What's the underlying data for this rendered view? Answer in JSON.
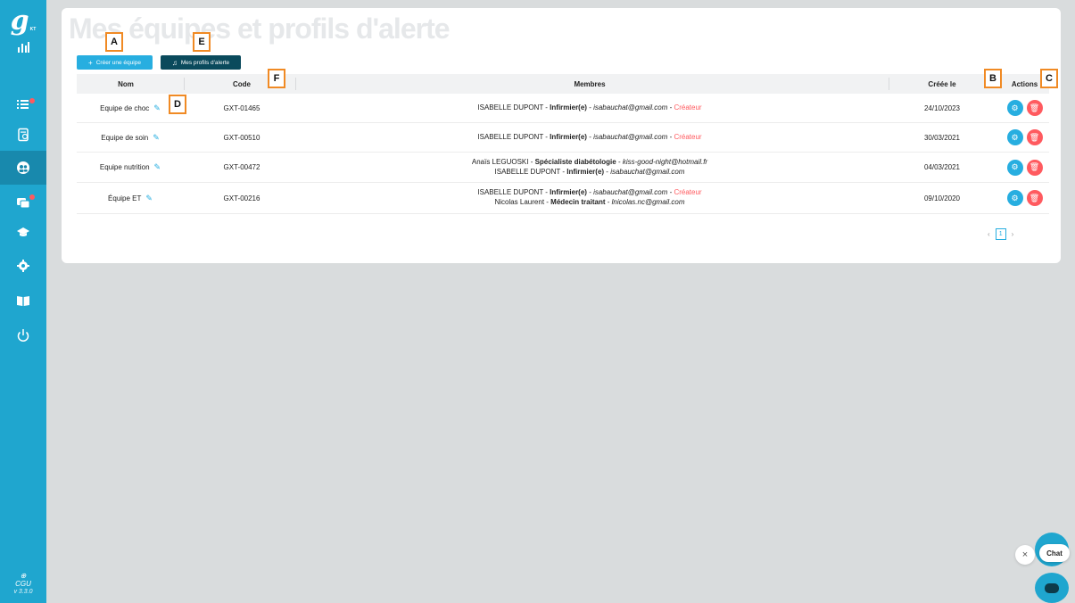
{
  "app": {
    "logo_letter": "g",
    "logo_sub": "KT"
  },
  "page": {
    "title": "Mes équipes et profils d'alerte"
  },
  "toolbar": {
    "create_team_label": "Créer une équipe",
    "alert_profiles_label": "Mes profils d'alerte"
  },
  "table": {
    "headers": {
      "name": "Nom",
      "code": "Code",
      "members": "Membres",
      "created": "Créée le",
      "actions": "Actions"
    },
    "rows": [
      {
        "name": "Equipe de choc",
        "code": "GXT-01465",
        "created": "24/10/2023",
        "members": [
          {
            "name": "ISABELLE DUPONT",
            "role": "Infirmier(e)",
            "email": "isabauchat@gmail.com",
            "tag": "Créateur"
          }
        ]
      },
      {
        "name": "Equipe de soin",
        "code": "GXT-00510",
        "created": "30/03/2021",
        "members": [
          {
            "name": "ISABELLE DUPONT",
            "role": "Infirmier(e)",
            "email": "isabauchat@gmail.com",
            "tag": "Créateur"
          }
        ]
      },
      {
        "name": "Equipe nutrition",
        "code": "GXT-00472",
        "created": "04/03/2021",
        "members": [
          {
            "name": "Anaïs LEGUOSKI",
            "role": "Spécialiste diabétologie",
            "email": "kiss-good-night@hotmail.fr",
            "tag": ""
          },
          {
            "name": "ISABELLE DUPONT",
            "role": "Infirmier(e)",
            "email": "isabauchat@gmail.com",
            "tag": ""
          }
        ]
      },
      {
        "name": "Équipe ET",
        "code": "GXT-00216",
        "created": "09/10/2020",
        "members": [
          {
            "name": "ISABELLE DUPONT",
            "role": "Infirmier(e)",
            "email": "isabauchat@gmail.com",
            "tag": "Créateur"
          },
          {
            "name": "Nicolas Laurent",
            "role": "Médecin traitant",
            "email": "lnicolas.nc@gmail.com",
            "tag": ""
          }
        ]
      }
    ]
  },
  "pagination": {
    "current": "1",
    "prev": "‹",
    "next": "›"
  },
  "markers": {
    "a": "A",
    "b": "B",
    "c": "C",
    "d": "D",
    "e": "E",
    "f": "F"
  },
  "footer": {
    "cgu": "CGU",
    "version": "v 3.3.0"
  },
  "chat": {
    "label": "Chat",
    "close": "×"
  },
  "colors": {
    "sidebar": "#1fa6cf",
    "primary": "#27aee0",
    "danger": "#ff5a5f",
    "dark_button": "#0a4a5c",
    "marker_border": "#f08a24"
  },
  "icons": {
    "nav": [
      "chart-icon",
      "list-icon",
      "document-icon",
      "teams-icon",
      "chat-icon",
      "graduation-icon",
      "settings-icon",
      "book-icon",
      "power-icon"
    ]
  }
}
